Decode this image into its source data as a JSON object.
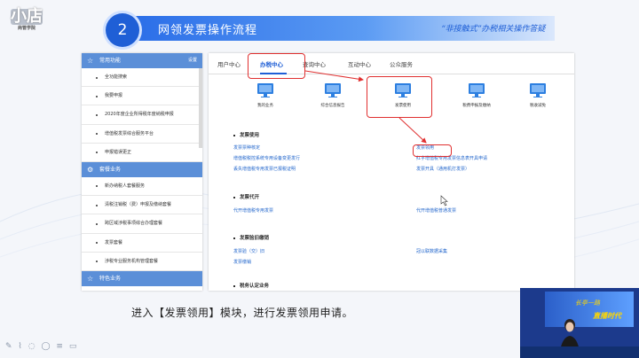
{
  "logo": {
    "big": "小店",
    "small": "商管学院"
  },
  "header": {
    "step_number": "2",
    "title": "网领发票操作流程",
    "subtitle": "“非接触式”办税相关操作答疑"
  },
  "sidebar": {
    "common_title": "常用功能",
    "setting_label": "设置",
    "common_items": [
      "全功能搜索",
      "我要申报",
      "2020年度企业所得税年度纳税申报",
      "增值税发票综合服务平台",
      "申报错误更正"
    ],
    "business_title": "套餐业务",
    "business_items": [
      "新办纳税人套餐服务",
      "清税注销税（费）申报及缴纳套餐",
      "跨区域涉税事项综合办理套餐",
      "发票套餐",
      "涉税专业服务机构管理套餐"
    ],
    "special_title": "特色业务"
  },
  "main": {
    "tabs": [
      "用户中心",
      "办税中心",
      "查询中心",
      "互动中心",
      "公众服务"
    ],
    "functions": [
      "我的业务",
      "综合信息报告",
      "发票使用",
      "税费申报及缴纳",
      "税收减免"
    ],
    "sections": {
      "invoice_use": {
        "title": "发票使用",
        "links": [
          "发票票种核定",
          "发票领用",
          "增值税税控系统专用设备变更发行",
          "红字增值税专用发票信息表开具申请",
          "丢失增值税专用发票已报税证明",
          "发票开具（通用机打发票）"
        ]
      },
      "invoice_issue": {
        "title": "发票代开",
        "links": [
          "代开增值税专用发票",
          "代开增值税普通发票"
        ]
      },
      "invoice_cancel": {
        "title": "发票验旧缴销",
        "links": [
          "发票验（交）旧",
          "冠以联数据采集",
          "发票缴销"
        ]
      },
      "partial": {
        "title": "税务认定业务"
      }
    }
  },
  "caption": "进入【发票领用】模块，进行发票领用申请。",
  "video": {
    "line1": "长亭一路",
    "line2": "直播时代"
  },
  "colors": {
    "accent": "#1f5fd6",
    "highlight": "#e03030"
  }
}
